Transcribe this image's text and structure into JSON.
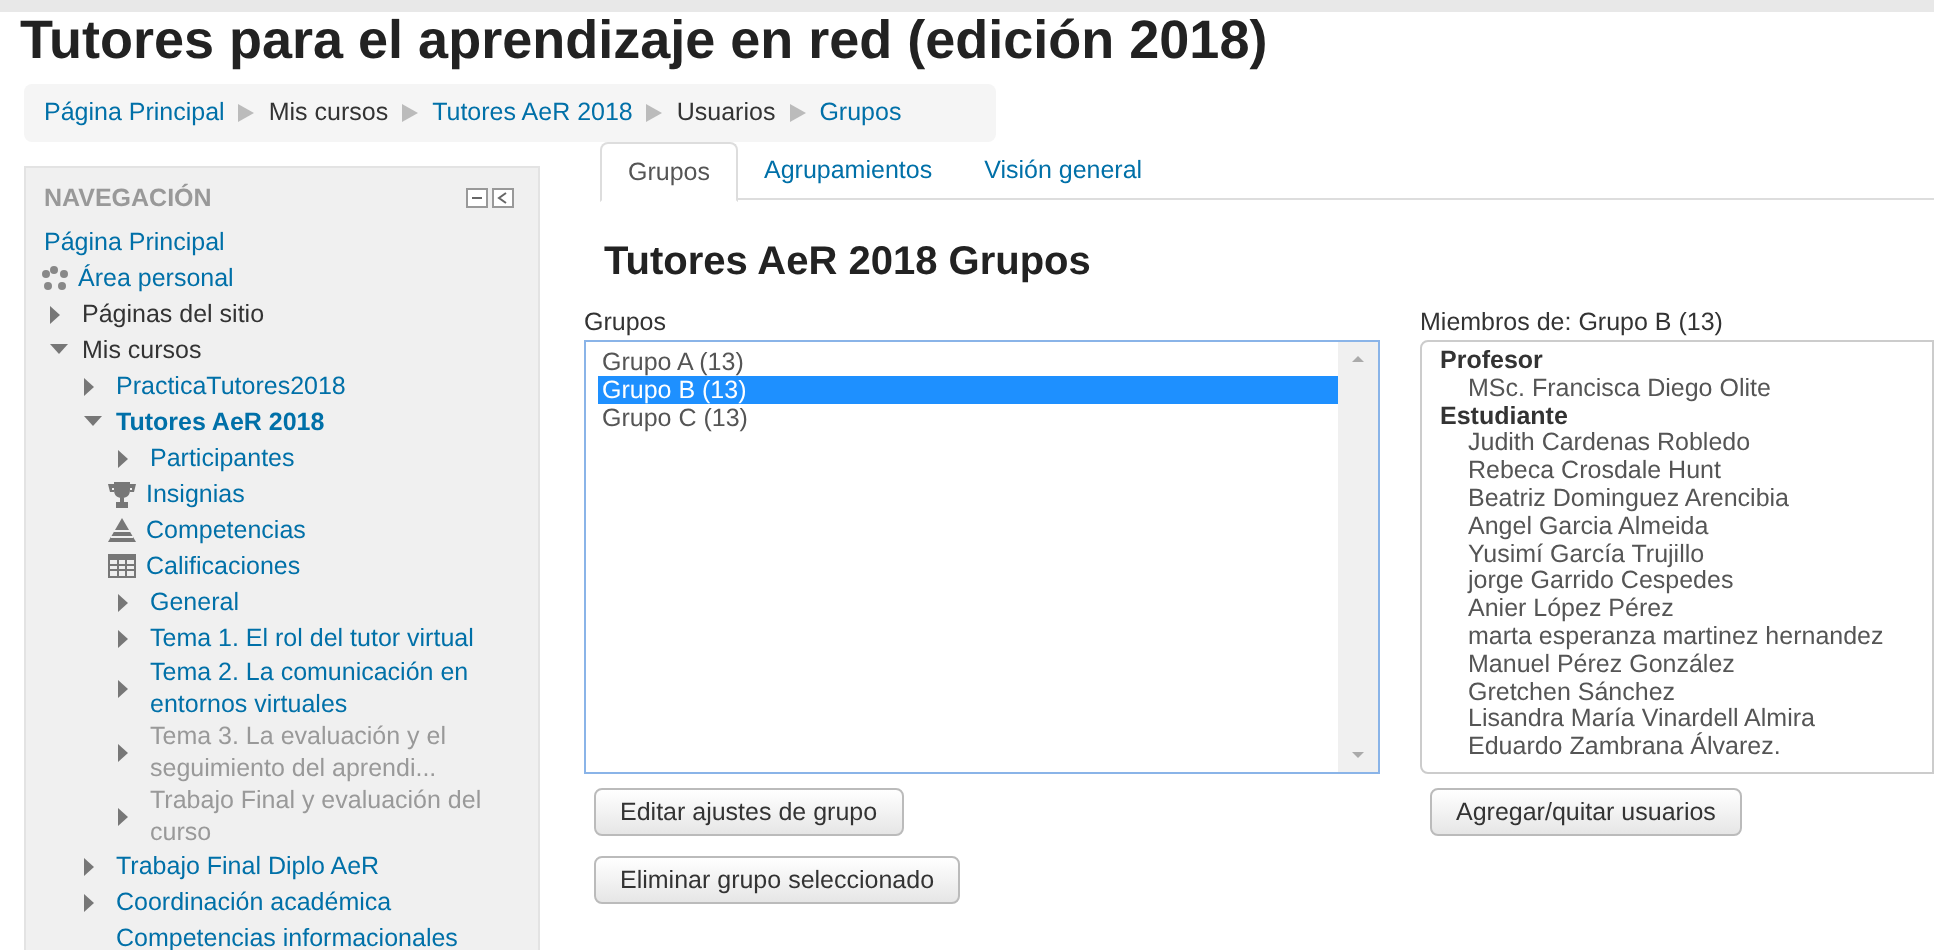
{
  "page_title": "Tutores para el aprendizaje en red (edición 2018)",
  "breadcrumb": [
    {
      "label": "Página Principal",
      "linked": true
    },
    {
      "label": "Mis cursos",
      "linked": false
    },
    {
      "label": "Tutores AeR 2018",
      "linked": true
    },
    {
      "label": "Usuarios",
      "linked": false
    },
    {
      "label": "Grupos",
      "linked": true
    }
  ],
  "navigation": {
    "title": "NAVEGACIÓN",
    "items": [
      {
        "label": "Página Principal",
        "kind": "link",
        "linked": true,
        "dimmed": false,
        "current": false
      },
      {
        "label": "Área personal",
        "kind": "dashboard",
        "linked": true,
        "dimmed": false,
        "current": false
      },
      {
        "label": "Páginas del sitio",
        "kind": "branch",
        "expanded": false,
        "linked": false,
        "dimmed": false,
        "current": false
      },
      {
        "label": "Mis cursos",
        "kind": "branch",
        "expanded": true,
        "linked": false,
        "dimmed": false,
        "current": false,
        "children": [
          {
            "label": "PracticaTutores2018",
            "kind": "branch",
            "expanded": false,
            "linked": true,
            "dimmed": false,
            "current": false
          },
          {
            "label": "Tutores AeR 2018",
            "kind": "branch",
            "expanded": true,
            "linked": true,
            "dimmed": false,
            "current": true,
            "children": [
              {
                "label": "Participantes",
                "kind": "branch",
                "expanded": false,
                "linked": true,
                "dimmed": false,
                "current": false
              },
              {
                "label": "Insignias",
                "kind": "trophy",
                "linked": true,
                "dimmed": false,
                "current": false
              },
              {
                "label": "Competencias",
                "kind": "pyramid",
                "linked": true,
                "dimmed": false,
                "current": false
              },
              {
                "label": "Calificaciones",
                "kind": "table",
                "linked": true,
                "dimmed": false,
                "current": false
              },
              {
                "label": "General",
                "kind": "branch",
                "expanded": false,
                "linked": true,
                "dimmed": false,
                "current": false
              },
              {
                "label": "Tema 1. El rol del tutor virtual",
                "kind": "branch",
                "expanded": false,
                "linked": true,
                "dimmed": false,
                "current": false
              },
              {
                "label": "Tema 2. La comunicación en entornos virtuales",
                "kind": "branch",
                "expanded": false,
                "linked": true,
                "dimmed": false,
                "current": false
              },
              {
                "label": "Tema 3. La evaluación y el seguimiento del aprendi...",
                "kind": "branch",
                "expanded": false,
                "dimmed": true,
                "current": false
              },
              {
                "label": "Trabajo Final y evaluación del curso",
                "kind": "branch",
                "expanded": false,
                "dimmed": true,
                "current": false
              }
            ]
          },
          {
            "label": "Trabajo Final Diplo AeR",
            "kind": "branch",
            "expanded": false,
            "linked": true,
            "dimmed": false,
            "current": false
          },
          {
            "label": "Coordinación académica",
            "kind": "branch",
            "expanded": false,
            "linked": true,
            "dimmed": false,
            "current": false
          },
          {
            "label": "Competencias informacionales",
            "kind": "link",
            "linked": true,
            "dimmed": false,
            "current": false
          }
        ]
      }
    ]
  },
  "tabs": [
    {
      "label": "Grupos",
      "selected": true
    },
    {
      "label": "Agrupamientos",
      "selected": false
    },
    {
      "label": "Visión general",
      "selected": false
    }
  ],
  "heading": "Tutores AeR 2018 Grupos",
  "groups": {
    "label": "Grupos",
    "options": [
      {
        "label": "Grupo A (13)",
        "selected": false
      },
      {
        "label": "Grupo B (13)",
        "selected": true
      },
      {
        "label": "Grupo C (13)",
        "selected": false
      }
    ],
    "buttons": [
      "Editar ajustes de grupo",
      "Eliminar grupo seleccionado"
    ]
  },
  "members": {
    "label": "Miembros de: Grupo B (13)",
    "roles": [
      {
        "role": "Profesor",
        "names": [
          "MSc. Francisca Diego Olite"
        ]
      },
      {
        "role": "Estudiante",
        "names": [
          "Judith Cardenas Robledo",
          "Rebeca Crosdale Hunt",
          "Beatriz Dominguez Arencibia",
          "Angel Garcia Almeida",
          "Yusimí García Trujillo",
          "jorge Garrido Cespedes",
          "Anier López Pérez",
          "marta esperanza martinez hernandez",
          "Manuel Pérez González",
          "Gretchen Sánchez",
          "Lisandra María Vinardell Almira",
          "Eduardo Zambrana Álvarez."
        ]
      }
    ],
    "button": "Agregar/quitar usuarios"
  }
}
